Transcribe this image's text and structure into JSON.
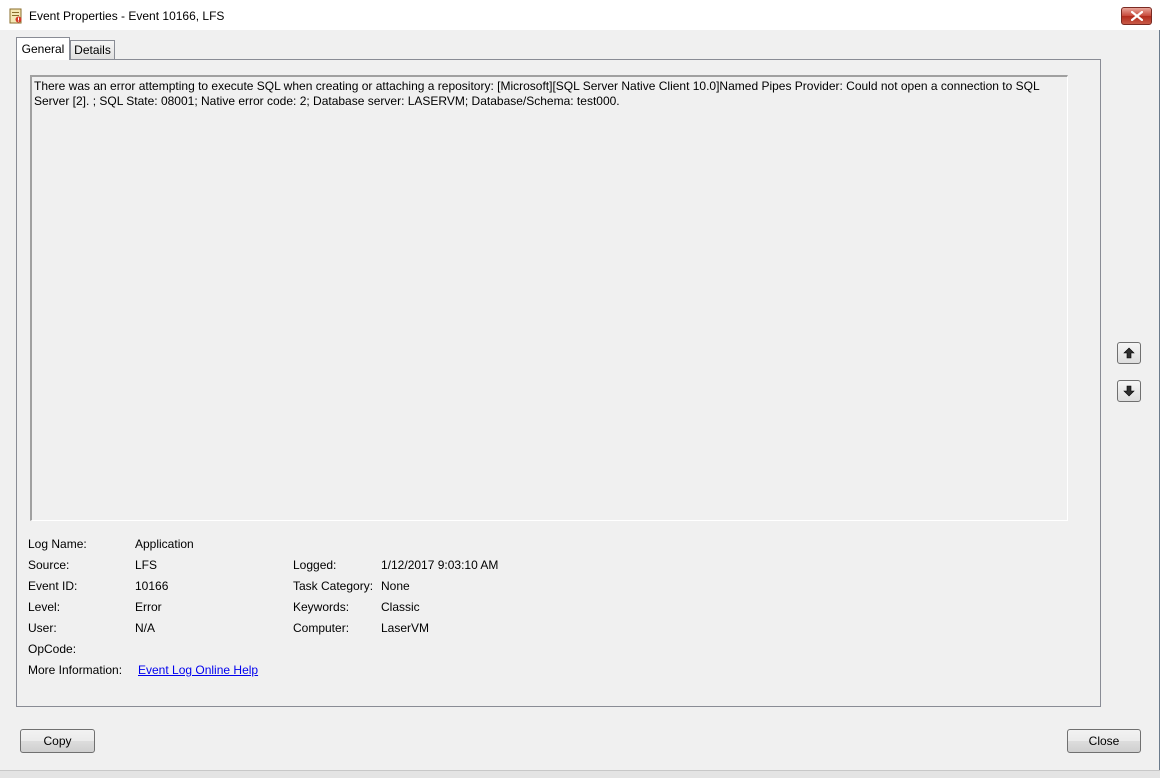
{
  "window": {
    "title": "Event Properties - Event 10166, LFS",
    "icon": "event-viewer-icon"
  },
  "tabs": [
    {
      "label": "General",
      "selected": true
    },
    {
      "label": "Details",
      "selected": false
    }
  ],
  "message": "There was an error attempting to execute SQL when creating or attaching a repository: [Microsoft][SQL Server Native Client 10.0]Named Pipes Provider: Could not open a connection to SQL Server [2]. ; SQL State: 08001; Native error code: 2; Database server: LASERVM; Database/Schema: test000.",
  "fields": {
    "log_name": {
      "label": "Log Name:",
      "value": "Application"
    },
    "source": {
      "label": "Source:",
      "value": "LFS"
    },
    "event_id": {
      "label": "Event ID:",
      "value": "10166"
    },
    "level": {
      "label": "Level:",
      "value": "Error"
    },
    "user": {
      "label": "User:",
      "value": "N/A"
    },
    "opcode": {
      "label": "OpCode:",
      "value": ""
    },
    "more_info": {
      "label": "More Information:",
      "link": "Event Log Online Help"
    },
    "logged": {
      "label": "Logged:",
      "value": "1/12/2017 9:03:10 AM"
    },
    "task_category": {
      "label": "Task Category:",
      "value": "None"
    },
    "keywords": {
      "label": "Keywords:",
      "value": "Classic"
    },
    "computer": {
      "label": "Computer:",
      "value": "LaserVM"
    }
  },
  "buttons": {
    "copy": "Copy",
    "close": "Close"
  },
  "nav": {
    "up_icon": "arrow-up-icon",
    "down_icon": "arrow-down-icon"
  },
  "colors": {
    "close_button": "#c7483a",
    "link": "#0000ee",
    "window_bg": "#f0f0f0"
  }
}
